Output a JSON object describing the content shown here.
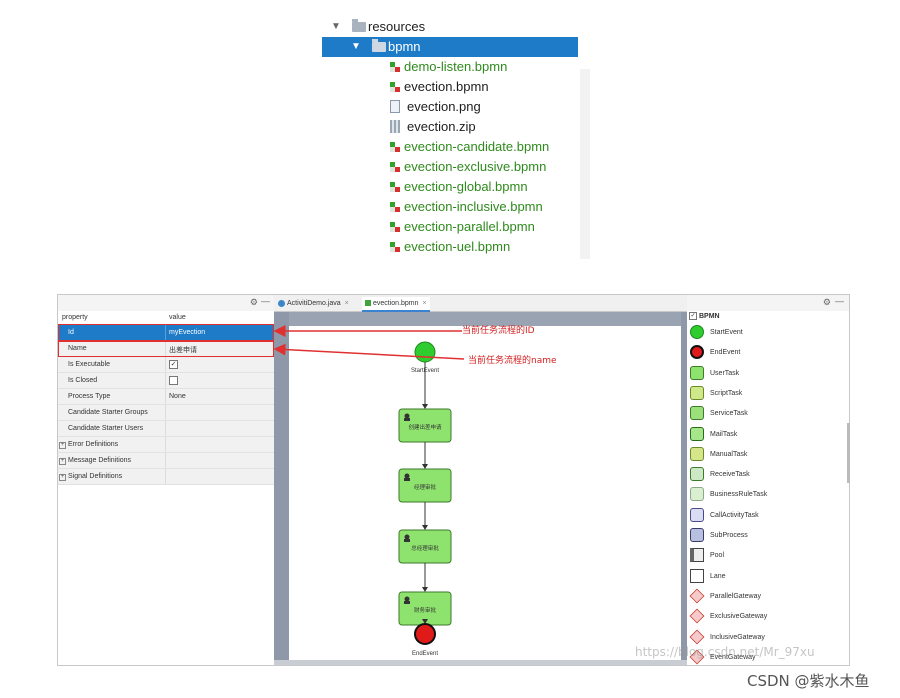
{
  "project_tree": {
    "items": [
      {
        "label": "resources",
        "kind": "folder",
        "expanded": true,
        "indent": 0,
        "selected": false,
        "color": "#1e1e1e"
      },
      {
        "label": "bpmn",
        "kind": "folder",
        "expanded": true,
        "indent": 1,
        "selected": true,
        "color": "#ffffff"
      },
      {
        "label": "demo-listen.bpmn",
        "kind": "bpmn",
        "indent": 2,
        "color": "#2f8a1d"
      },
      {
        "label": "evection.bpmn",
        "kind": "bpmn",
        "indent": 2,
        "color": "#1e1e1e"
      },
      {
        "label": "evection.png",
        "kind": "image",
        "indent": 2,
        "color": "#1e1e1e"
      },
      {
        "label": "evection.zip",
        "kind": "zip",
        "indent": 2,
        "color": "#1e1e1e"
      },
      {
        "label": "evection-candidate.bpmn",
        "kind": "bpmn",
        "indent": 2,
        "color": "#2f8a1d"
      },
      {
        "label": "evection-exclusive.bpmn",
        "kind": "bpmn",
        "indent": 2,
        "color": "#2f8a1d"
      },
      {
        "label": "evection-global.bpmn",
        "kind": "bpmn",
        "indent": 2,
        "color": "#2f8a1d"
      },
      {
        "label": "evection-inclusive.bpmn",
        "kind": "bpmn",
        "indent": 2,
        "color": "#2f8a1d"
      },
      {
        "label": "evection-parallel.bpmn",
        "kind": "bpmn",
        "indent": 2,
        "color": "#2f8a1d"
      },
      {
        "label": "evection-uel.bpmn",
        "kind": "bpmn",
        "indent": 2,
        "color": "#2f8a1d"
      }
    ]
  },
  "properties": {
    "header": {
      "property": "property",
      "value": "value"
    },
    "rows": [
      {
        "key": "Id",
        "value": "myEvection",
        "selected": true
      },
      {
        "key": "Name",
        "value": "出差申请"
      },
      {
        "key": "Is Executable",
        "check": true
      },
      {
        "key": "Is Closed",
        "check": false
      },
      {
        "key": "Process Type",
        "value": "None"
      },
      {
        "key": "Candidate Starter Groups",
        "value": ""
      },
      {
        "key": "Candidate Starter Users",
        "value": ""
      },
      {
        "key": "Error Definitions",
        "value": "",
        "expandable": true
      },
      {
        "key": "Message Definitions",
        "value": "",
        "expandable": true
      },
      {
        "key": "Signal Definitions",
        "value": "",
        "expandable": true
      }
    ]
  },
  "editor": {
    "tabs": [
      {
        "label": "ActivitiDemo.java",
        "close": "×",
        "active": false
      },
      {
        "label": "evection.bpmn",
        "close": "×",
        "active": true
      }
    ],
    "diagram": {
      "start_label": "StartEvent",
      "end_label": "EndEvent",
      "tasks": [
        "创建出差申请",
        "经理审批",
        "总经理审批",
        "财务审批"
      ]
    }
  },
  "palette": {
    "header": "BPMN",
    "items": [
      {
        "label": "StartEvent",
        "icon": "start-event-icon"
      },
      {
        "label": "EndEvent",
        "icon": "end-event-icon"
      },
      {
        "label": "UserTask",
        "icon": "user-task-icon"
      },
      {
        "label": "ScriptTask",
        "icon": "script-task-icon"
      },
      {
        "label": "ServiceTask",
        "icon": "service-task-icon"
      },
      {
        "label": "MailTask",
        "icon": "mail-task-icon"
      },
      {
        "label": "ManualTask",
        "icon": "manual-task-icon"
      },
      {
        "label": "ReceiveTask",
        "icon": "receive-task-icon"
      },
      {
        "label": "BusinessRuleTask",
        "icon": "business-rule-task-icon"
      },
      {
        "label": "CallActivityTask",
        "icon": "call-activity-task-icon"
      },
      {
        "label": "SubProcess",
        "icon": "subprocess-icon"
      },
      {
        "label": "Pool",
        "icon": "pool-icon"
      },
      {
        "label": "Lane",
        "icon": "lane-icon"
      },
      {
        "label": "ParallelGateway",
        "icon": "parallel-gateway-icon"
      },
      {
        "label": "ExclusiveGateway",
        "icon": "exclusive-gateway-icon"
      },
      {
        "label": "InclusiveGateway",
        "icon": "inclusive-gateway-icon"
      },
      {
        "label": "EventGateway",
        "icon": "event-gateway-icon"
      }
    ]
  },
  "annotations": {
    "id_note": "当前任务流程的ID",
    "name_note": "当前任务流程的name"
  },
  "watermarks": {
    "url": "https://blog.csdn.net/Mr_97xu",
    "author": "CSDN @紫水木鱼"
  },
  "colors": {
    "selection": "#1e7bc8",
    "canvas_bg": "#8f98a8",
    "task_fill": "#8ee36e",
    "start_fill": "#2ecc2e",
    "end_fill": "#e01919",
    "annotation": "#e03030"
  }
}
